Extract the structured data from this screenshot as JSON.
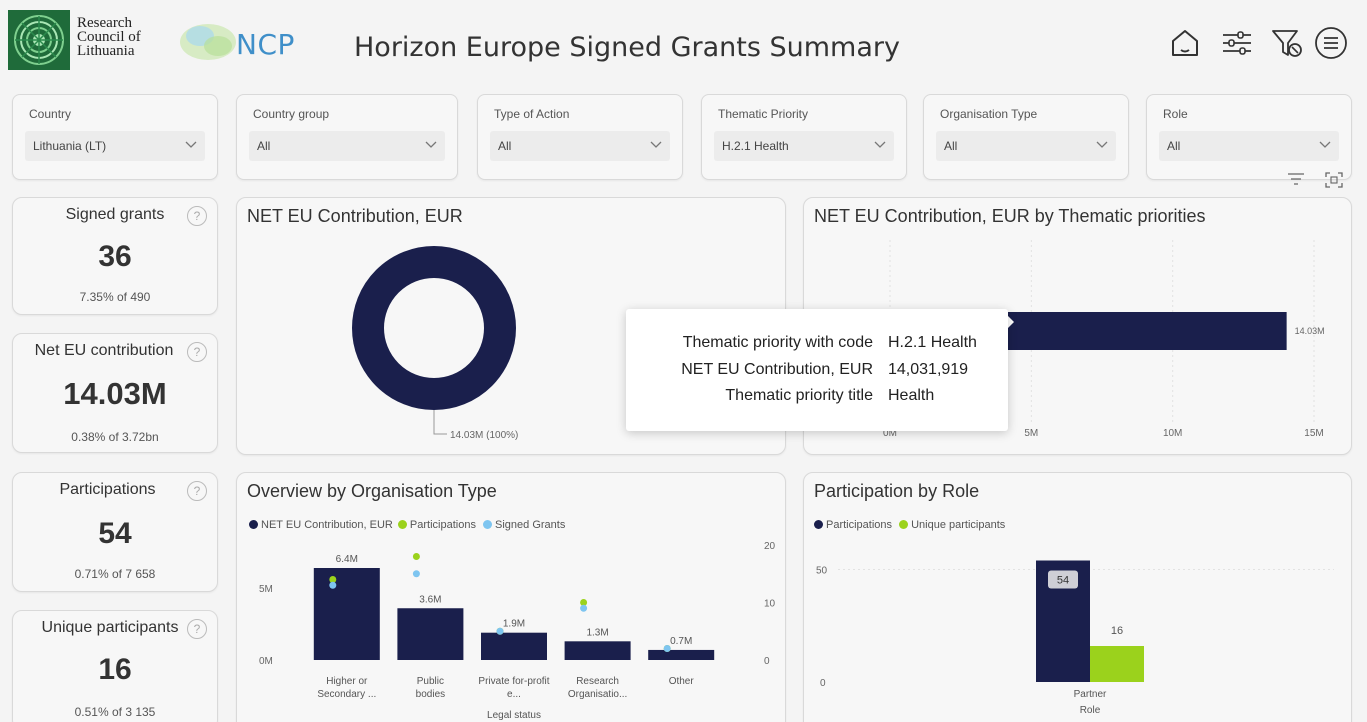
{
  "header": {
    "rcl_line1": "Research",
    "rcl_line2": "Council of",
    "rcl_line3": "Lithuania",
    "ncp_label": "NCP",
    "title": "Horizon Europe Signed Grants Summary",
    "icons": [
      "home-icon",
      "sliders-icon",
      "filter-clear-icon",
      "menu-icon"
    ]
  },
  "filters": [
    {
      "label": "Country",
      "value": "Lithuania (LT)"
    },
    {
      "label": "Country group",
      "value": "All"
    },
    {
      "label": "Type of Action",
      "value": "All"
    },
    {
      "label": "Thematic Priority",
      "value": "H.2.1 Health"
    },
    {
      "label": "Organisation Type",
      "value": "All"
    },
    {
      "label": "Role",
      "value": "All"
    }
  ],
  "kpis": {
    "signed_grants": {
      "label": "Signed grants",
      "value": "36",
      "sub": "7.35% of 490"
    },
    "net_eu": {
      "label": "Net EU contribution",
      "value": "14.03M",
      "sub": "0.38% of 3.72bn"
    },
    "participations": {
      "label": "Participations",
      "value": "54",
      "sub": "0.71% of 7 658"
    },
    "unique": {
      "label": "Unique participants",
      "value": "16",
      "sub": "0.51% of 3 135"
    }
  },
  "colors": {
    "navy": "#1a1f4c",
    "green": "#9bd21c",
    "lightblue": "#7ec5f0"
  },
  "donut": {
    "title": "NET EU Contribution, EUR",
    "label": "14.03M (100%)"
  },
  "thematic": {
    "title": "NET EU Contribution, EUR by Thematic priorities",
    "bar_label": "14.03M"
  },
  "tooltip": {
    "k1": "Thematic priority with code",
    "v1": "H.2.1 Health",
    "k2": "NET EU Contribution, EUR",
    "v2": "14,031,919",
    "k3": "Thematic priority title",
    "v3": "Health"
  },
  "org_type": {
    "title": "Overview by Organisation Type",
    "legend": [
      "NET EU Contribution, EUR",
      "Participations",
      "Signed Grants"
    ],
    "xlabel": "Legal status"
  },
  "role": {
    "title": "Participation by Role",
    "legend": [
      "Participations",
      "Unique participants"
    ],
    "xlabel": "Role"
  },
  "chart_data": [
    {
      "type": "pie",
      "title": "NET EU Contribution, EUR",
      "values": [
        14.03
      ],
      "labels": [
        "14.03M (100%)"
      ]
    },
    {
      "type": "bar",
      "title": "NET EU Contribution, EUR by Thematic priorities",
      "orientation": "horizontal",
      "categories": [
        "H.2.1 Health"
      ],
      "values": [
        14031919
      ],
      "data_labels": [
        "14.03M"
      ],
      "x_ticks": [
        "0M",
        "5M",
        "10M",
        "15M"
      ],
      "xlim": [
        0,
        15000000
      ]
    },
    {
      "type": "bar",
      "title": "Overview by Organisation Type",
      "categories": [
        "Higher or Secondary ...",
        "Public bodies",
        "Private for-profit e...",
        "Research Organisatio...",
        "Other"
      ],
      "xlabel": "Legal status",
      "series": [
        {
          "name": "NET EU Contribution, EUR",
          "values": [
            6.4,
            3.6,
            1.9,
            1.3,
            0.7
          ],
          "labels": [
            "6.4M",
            "3.6M",
            "1.9M",
            "1.3M",
            "0.7M"
          ]
        },
        {
          "name": "Participations",
          "values": [
            14,
            18,
            5,
            10,
            2
          ]
        },
        {
          "name": "Signed Grants",
          "values": [
            13,
            15,
            5,
            9,
            2
          ]
        }
      ],
      "y_ticks_left": [
        "0M",
        "5M"
      ],
      "y_ticks_right": [
        "0",
        "10",
        "20"
      ],
      "ylim_left": [
        0,
        8
      ],
      "ylim_right": [
        0,
        20
      ]
    },
    {
      "type": "bar",
      "title": "Participation by Role",
      "categories": [
        "Partner"
      ],
      "xlabel": "Role",
      "series": [
        {
          "name": "Participations",
          "values": [
            54
          ],
          "labels": [
            "54"
          ]
        },
        {
          "name": "Unique participants",
          "values": [
            16
          ],
          "labels": [
            "16"
          ]
        }
      ],
      "y_ticks": [
        "0",
        "50"
      ],
      "ylim": [
        0,
        60
      ]
    }
  ]
}
